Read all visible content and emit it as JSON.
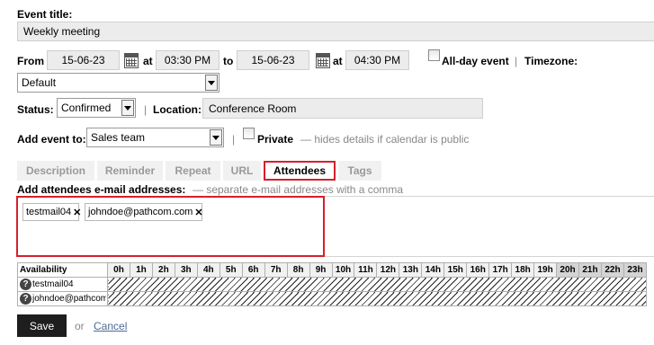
{
  "event_title": {
    "label": "Event title:",
    "value": "Weekly meeting"
  },
  "from": {
    "label": "From",
    "date": "15-06-23",
    "at_label": "at",
    "time": "03:30 PM"
  },
  "to": {
    "label": "to",
    "date": "15-06-23",
    "at_label": "at",
    "time": "04:30 PM"
  },
  "all_day": {
    "label": "All-day event",
    "checked": false
  },
  "timezone": {
    "label": "Timezone:",
    "value": "Default"
  },
  "status": {
    "label": "Status:",
    "value": "Confirmed"
  },
  "location": {
    "label": "Location:",
    "value": "Conference Room"
  },
  "add_event_to": {
    "label": "Add event to:",
    "value": "Sales team"
  },
  "private": {
    "label": "Private",
    "checked": false,
    "hint": "— hides details if calendar is public"
  },
  "separator": "|",
  "tabs": [
    {
      "label": "Description",
      "active": false
    },
    {
      "label": "Reminder",
      "active": false
    },
    {
      "label": "Repeat",
      "active": false
    },
    {
      "label": "URL",
      "active": false
    },
    {
      "label": "Attendees",
      "active": true
    },
    {
      "label": "Tags",
      "active": false
    }
  ],
  "attendees": {
    "label": "Add attendees e-mail addresses:",
    "hint": "— separate e-mail addresses with a comma",
    "chips": [
      "testmail04",
      "johndoe@pathcom.com"
    ],
    "remove_glyph": "✕"
  },
  "availability": {
    "header": "Availability",
    "hours": [
      "0h",
      "1h",
      "2h",
      "3h",
      "4h",
      "5h",
      "6h",
      "7h",
      "8h",
      "9h",
      "10h",
      "11h",
      "12h",
      "13h",
      "14h",
      "15h",
      "16h",
      "17h",
      "18h",
      "19h",
      "20h",
      "21h",
      "22h",
      "23h"
    ],
    "rows": [
      {
        "name": "testmail04"
      },
      {
        "name": "johndoe@pathcom.com"
      }
    ],
    "unknown_icon": "?"
  },
  "actions": {
    "save_label": "Save",
    "or_label": "or",
    "cancel_label": "Cancel"
  },
  "colors": {
    "highlight": "#d6202b",
    "field_bg": "#ececec",
    "link": "#4d6a9a",
    "save_bg": "#1e1e1e"
  },
  "icons": {
    "calendar": "calendar-icon",
    "dropdown": "chevron-down-icon",
    "remove": "close-icon",
    "unknown": "question-icon"
  }
}
